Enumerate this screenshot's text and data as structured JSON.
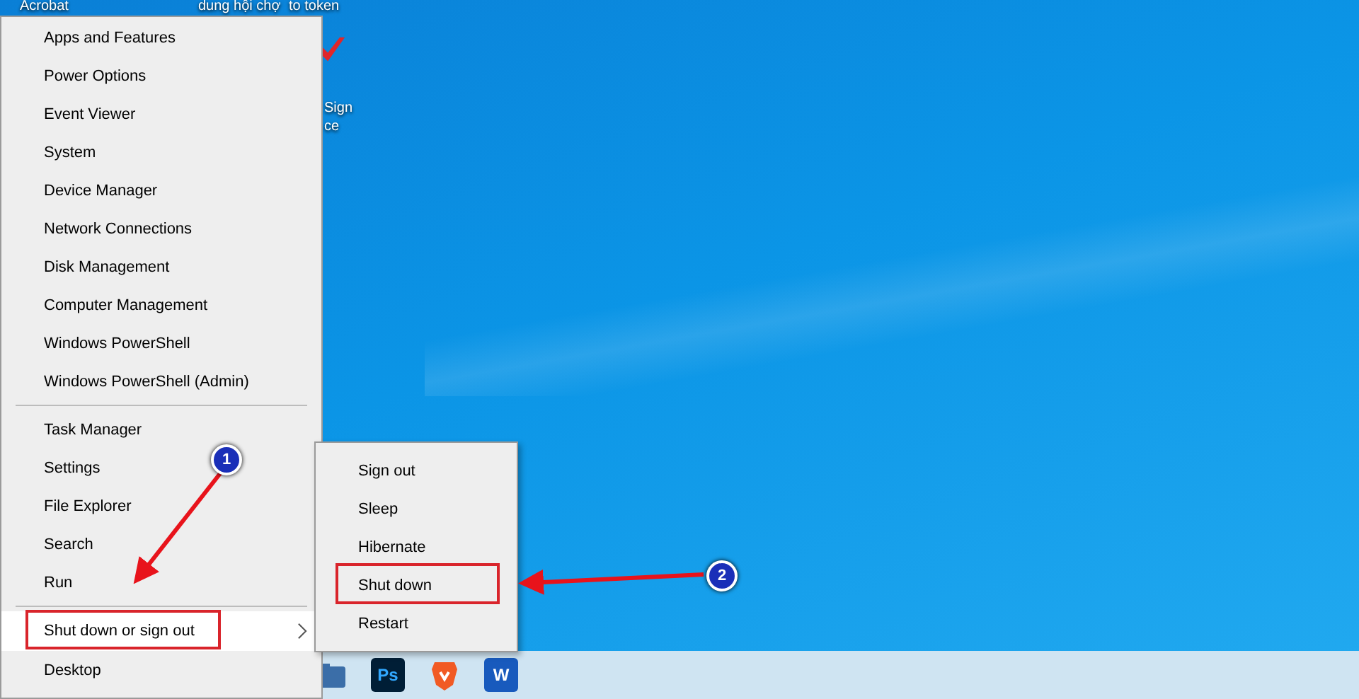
{
  "desktop_icons": [
    {
      "label": "Acrobat"
    },
    {
      "label": "dung hội chợ"
    },
    {
      "label": "to token"
    },
    {
      "label": "Sign"
    },
    {
      "label": "ce"
    }
  ],
  "menu": {
    "groups": [
      [
        {
          "label": "Apps and Features",
          "selected": false,
          "has_submenu": false,
          "boxed": false
        },
        {
          "label": "Power Options",
          "selected": false,
          "has_submenu": false,
          "boxed": false
        },
        {
          "label": "Event Viewer",
          "selected": false,
          "has_submenu": false,
          "boxed": false
        },
        {
          "label": "System",
          "selected": false,
          "has_submenu": false,
          "boxed": false
        },
        {
          "label": "Device Manager",
          "selected": false,
          "has_submenu": false,
          "boxed": false
        },
        {
          "label": "Network Connections",
          "selected": false,
          "has_submenu": false,
          "boxed": false
        },
        {
          "label": "Disk Management",
          "selected": false,
          "has_submenu": false,
          "boxed": false
        },
        {
          "label": "Computer Management",
          "selected": false,
          "has_submenu": false,
          "boxed": false
        },
        {
          "label": "Windows PowerShell",
          "selected": false,
          "has_submenu": false,
          "boxed": false
        },
        {
          "label": "Windows PowerShell (Admin)",
          "selected": false,
          "has_submenu": false,
          "boxed": false
        }
      ],
      [
        {
          "label": "Task Manager",
          "selected": false,
          "has_submenu": false,
          "boxed": false
        },
        {
          "label": "Settings",
          "selected": false,
          "has_submenu": false,
          "boxed": false
        },
        {
          "label": "File Explorer",
          "selected": false,
          "has_submenu": false,
          "boxed": false
        },
        {
          "label": "Search",
          "selected": false,
          "has_submenu": false,
          "boxed": false
        },
        {
          "label": "Run",
          "selected": false,
          "has_submenu": false,
          "boxed": false
        }
      ],
      [
        {
          "label": "Shut down or sign out",
          "selected": true,
          "has_submenu": true,
          "boxed": true
        },
        {
          "label": "Desktop",
          "selected": false,
          "has_submenu": false,
          "boxed": false
        }
      ]
    ]
  },
  "submenu": {
    "items": [
      {
        "label": "Sign out",
        "selected": false,
        "boxed": false
      },
      {
        "label": "Sleep",
        "selected": false,
        "boxed": false
      },
      {
        "label": "Hibernate",
        "selected": false,
        "boxed": false
      },
      {
        "label": "Shut down",
        "selected": false,
        "boxed": true
      },
      {
        "label": "Restart",
        "selected": false,
        "boxed": false
      }
    ]
  },
  "taskbar": {
    "icons": [
      {
        "kind": "folder"
      },
      {
        "kind": "photoshop",
        "label": "Ps"
      },
      {
        "kind": "brave"
      },
      {
        "kind": "word",
        "label": "W"
      }
    ]
  },
  "annotations": [
    {
      "label": "1"
    },
    {
      "label": "2"
    }
  ]
}
